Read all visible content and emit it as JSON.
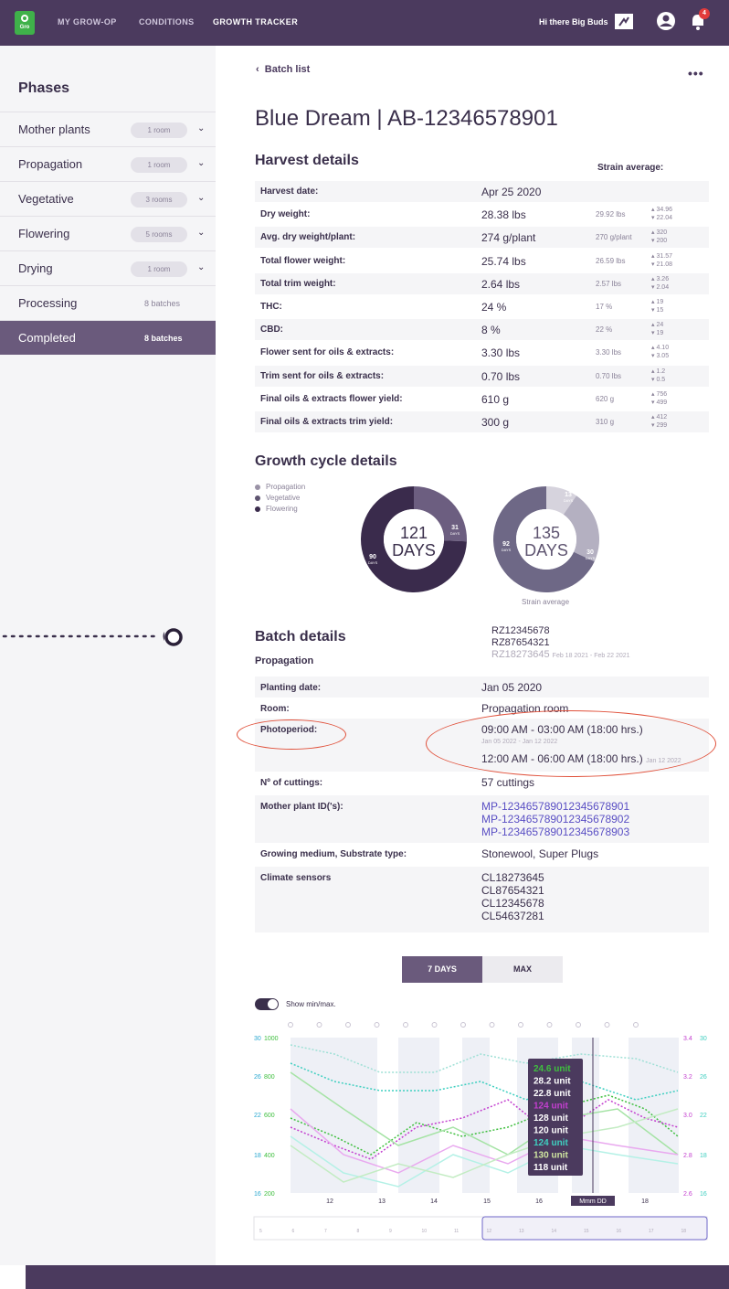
{
  "topnav": {
    "brand": "Gro",
    "items": [
      "MY GROW-OP",
      "CONDITIONS",
      "GROWTH TRACKER"
    ],
    "greeting": "Hi there Big Buds",
    "notifications": "4"
  },
  "sidebar": {
    "title": "Phases",
    "items": [
      {
        "label": "Mother plants",
        "count": "1 room"
      },
      {
        "label": "Propagation",
        "count": "1 room"
      },
      {
        "label": "Vegetative",
        "count": "3 rooms"
      },
      {
        "label": "Flowering",
        "count": "5 rooms"
      },
      {
        "label": "Drying",
        "count": "1 room"
      },
      {
        "label": "Processing",
        "count": "8 batches"
      },
      {
        "label": "Completed",
        "count": "8 batches"
      }
    ]
  },
  "main": {
    "back": "Batch list",
    "more": "•••",
    "title": "Blue Dream | AB-12346578901"
  },
  "harvest": {
    "title": "Harvest details",
    "strain_label": "Strain average:",
    "rows": [
      {
        "k": "Harvest date:",
        "v": "Apr 25 2020",
        "a": "",
        "max": "",
        "min": ""
      },
      {
        "k": "Dry weight:",
        "v": "28.38 lbs",
        "a": "29.92 lbs",
        "max": "34.96",
        "min": "22.04"
      },
      {
        "k": "Avg. dry weight/plant:",
        "v": "274 g/plant",
        "a": "270 g/plant",
        "max": "320",
        "min": "200"
      },
      {
        "k": "Total flower weight:",
        "v": "25.74 lbs",
        "a": "26.59 lbs",
        "max": "31.57",
        "min": "21.08"
      },
      {
        "k": "Total trim weight:",
        "v": "2.64 lbs",
        "a": "2.57 lbs",
        "max": "3.26",
        "min": "2.04"
      },
      {
        "k": "THC:",
        "v": "24 %",
        "a": "17 %",
        "max": "19",
        "min": "15"
      },
      {
        "k": "CBD:",
        "v": "8 %",
        "a": "22 %",
        "max": "24",
        "min": "19"
      },
      {
        "k": "Flower sent for oils & extracts:",
        "v": "3.30 lbs",
        "a": "3.30 lbs",
        "max": "4.10",
        "min": "3.05"
      },
      {
        "k": "Trim sent for oils & extracts:",
        "v": "0.70 lbs",
        "a": "0.70 lbs",
        "max": "1.2",
        "min": "0.5"
      },
      {
        "k": "Final oils & extracts flower yield:",
        "v": "610 g",
        "a": "620 g",
        "max": "756",
        "min": "499"
      },
      {
        "k": "Final oils & extracts trim yield:",
        "v": "300 g",
        "a": "310 g",
        "max": "412",
        "min": "299"
      }
    ]
  },
  "growth": {
    "title": "Growth cycle details",
    "legend": [
      "Propagation",
      "Vegetative",
      "Flowering"
    ],
    "batch": {
      "total": "121",
      "unit": "DAYS",
      "vegetative": "31",
      "flowering": "90",
      "seg_unit": "DAYS",
      "propagation_days": 0,
      "vegetative_days": 31,
      "flowering_days": 90
    },
    "strain": {
      "total": "135",
      "unit": "DAYS",
      "propagation": "13",
      "vegetative": "30",
      "flowering": "92",
      "seg_unit": "DAYS",
      "caption": "Strain average",
      "propagation_days": 13,
      "vegetative_days": 30,
      "flowering_days": 92
    }
  },
  "batch": {
    "title": "Batch details",
    "sub": "Propagation",
    "rooms": [
      "RZ12345678",
      "RZ87654321",
      "RZ18273645"
    ],
    "room_dates": "Feb 18 2021 - Feb 22 2021",
    "planting_k": "Planting date:",
    "planting_v": "Jan 05 2020",
    "room_k": "Room:",
    "room_v": "Propagation room",
    "photo_k": "Photoperiod:",
    "photo_v1": "09:00 AM - 03:00 AM  (18:00 hrs.)",
    "photo_d1": "Jan 05 2022 - Jan 12 2022",
    "photo_v2": "12:00 AM - 06:00 AM  (18:00 hrs.)",
    "photo_d2": "Jan 12 2022",
    "cuttings_k": "Nº of cuttings:",
    "cuttings_v": "57 cuttings",
    "mother_k": "Mother plant ID('s):",
    "mothers": [
      "MP-123465789012345678901",
      "MP-123465789012345678902",
      "MP-123465789012345678903"
    ],
    "medium_k": "Growing medium, Substrate type:",
    "medium_v": "Stonewool, Super Plugs",
    "climate_k": "Climate sensors",
    "climate": [
      "CL18273645",
      "CL87654321",
      "CL12345678",
      "CL54637281"
    ]
  },
  "controls": {
    "days7": "7 DAYS",
    "max": "MAX",
    "showmm": "Show min/max."
  },
  "chart_data": {
    "type": "line",
    "x": [
      "12",
      "13",
      "14",
      "15",
      "16",
      "Mmm DD",
      "18"
    ],
    "left_axis_a": [
      "30",
      "26",
      "22",
      "18",
      "16"
    ],
    "left_axis_b": [
      "1000",
      "800",
      "600",
      "400",
      "200"
    ],
    "right_axis_a": [
      "3.4",
      "3.2",
      "3.0",
      "2.8",
      "2.6"
    ],
    "right_axis_b": [
      "30",
      "26",
      "22",
      "18",
      "16"
    ],
    "tooltip": [
      {
        "v": "24.6 unit",
        "c": "#3fbf3f"
      },
      {
        "v": "28.2 unit",
        "c": "#ffffff"
      },
      {
        "v": "22.8 unit",
        "c": "#ffffff"
      },
      {
        "v": "124 unit",
        "c": "#c33fcf"
      },
      {
        "v": "128 unit",
        "c": "#ffffff"
      },
      {
        "v": "120 unit",
        "c": "#ffffff"
      },
      {
        "v": "124 unit",
        "c": "#3fcfc0"
      },
      {
        "v": "130 unit",
        "c": "#cfe6a0"
      },
      {
        "v": "118 unit",
        "c": "#ffffff"
      }
    ],
    "scrubber": [
      "5",
      "6",
      "7",
      "8",
      "9",
      "10",
      "11",
      "12",
      "13",
      "14",
      "15",
      "16",
      "17",
      "18"
    ]
  }
}
